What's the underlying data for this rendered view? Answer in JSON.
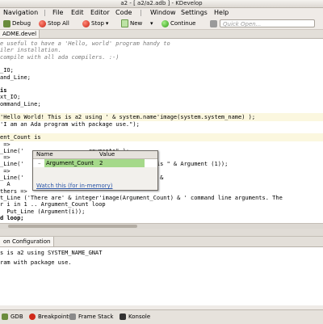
{
  "window": {
    "title": "a2 - [ a2/a2.adb ] - KDevelop"
  },
  "menu": [
    "Navigation",
    "|",
    "File",
    "Edit",
    "Editor",
    "Code",
    "|",
    "Window",
    "Settings",
    "Help"
  ],
  "toolbar": {
    "debug_label": "Debug",
    "stop_all_label": "Stop All",
    "stop_label": "Stop",
    "new_label": "New",
    "continue_label": "Continue",
    "quick_open_placeholder": "Quick Open..."
  },
  "doc_tab": "ADME.devel",
  "editor_lines": [
    {
      "text": "e useful to have a 'Hello, world' program handy to",
      "cls": "comment"
    },
    {
      "text": "iler installation.",
      "cls": "comment"
    },
    {
      "text": "compile with all ada compilers. :-)",
      "cls": "comment"
    },
    {
      "text": "",
      "cls": ""
    },
    {
      "text": "_IO;",
      "cls": ""
    },
    {
      "text": "and_Line;",
      "cls": ""
    },
    {
      "text": "",
      "cls": ""
    },
    {
      "text": "is",
      "cls": "kw"
    },
    {
      "text": "xt_IO;",
      "cls": ""
    },
    {
      "text": "ommand_Line;",
      "cls": ""
    },
    {
      "text": "",
      "cls": ""
    },
    {
      "text": "'Hello World! This is a2 using ' & system.name'image(system.system_name) );",
      "cls": "hl"
    },
    {
      "text": "'I am an Ada program with package use.\");",
      "cls": ""
    },
    {
      "text": "",
      "cls": ""
    },
    {
      "text": "ent_Count is",
      "cls": "hl"
    },
    {
      "text": " =>",
      "cls": ""
    },
    {
      "text": "_Line('                   rguments\" );",
      "cls": ""
    },
    {
      "text": " =>",
      "cls": ""
    },
    {
      "text": "_Line('                   ine argument and it is \" & Argument (1));",
      "cls": ""
    },
    {
      "text": " =>",
      "cls": ""
    },
    {
      "text": "_Line('                   guments.  They are \" &",
      "cls": ""
    },
    {
      "text": "  A",
      "cls": ""
    },
    {
      "text": "thers =>",
      "cls": ""
    },
    {
      "text": "t_Line ('There are' & integer'image(Argument_Count) & ' command line arguments. The",
      "cls": ""
    },
    {
      "text": "r i in 1 .. Argument_Count loop",
      "cls": ""
    },
    {
      "text": "  Put_Line (Argument(i));",
      "cls": ""
    },
    {
      "text": "d loop;",
      "cls": "kw"
    }
  ],
  "var_popup": {
    "col_name": "Name",
    "col_value": "Value",
    "var_name": "Argument_Count",
    "var_value": "2",
    "link": "Watch this (for in-memory)"
  },
  "output_tab": "on Configuration",
  "output_lines": [
    "s is a2 using SYSTEM_NAME_GNAT",
    "ram with package use."
  ],
  "status_tabs": [
    {
      "label": "GDB"
    },
    {
      "label": "Breakpoints"
    },
    {
      "label": "Frame Stack"
    },
    {
      "label": "Konsole"
    }
  ]
}
